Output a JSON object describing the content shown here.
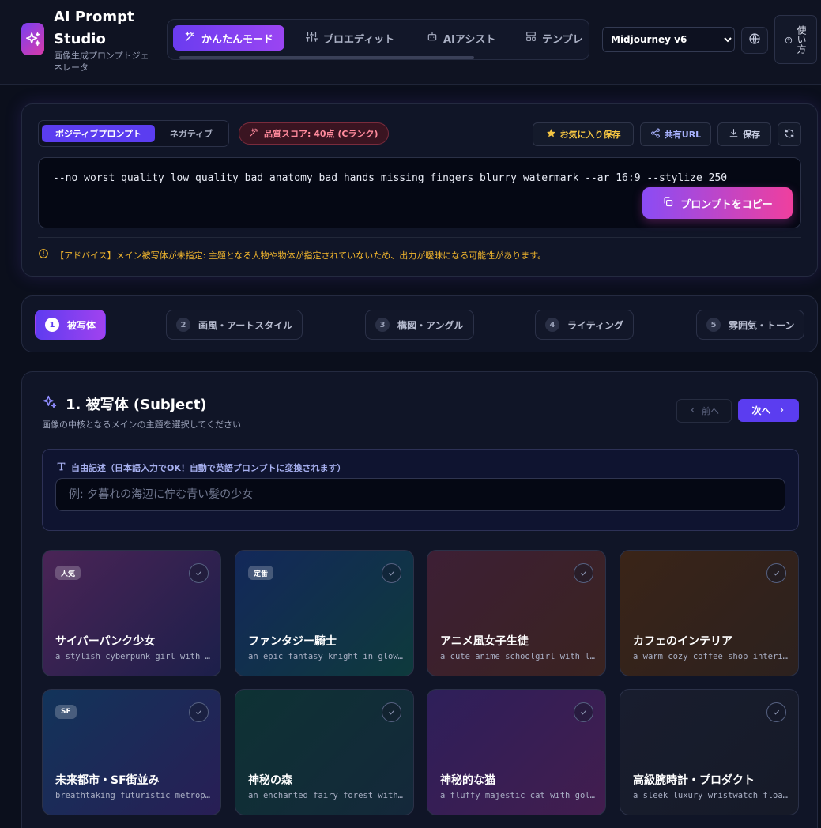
{
  "app": {
    "title": "AI Prompt Studio",
    "subtitle": "画像生成プロンプトジェネレータ"
  },
  "modes": [
    {
      "label": "かんたんモード",
      "icon": "magic-wand-icon",
      "active": true
    },
    {
      "label": "プロエディット",
      "icon": "sliders-icon",
      "active": false
    },
    {
      "label": "AIアシスト",
      "icon": "bot-icon",
      "active": false
    },
    {
      "label": "テンプレ",
      "icon": "layout-icon",
      "active": false
    }
  ],
  "model": {
    "selected": "Midjourney v6",
    "options": [
      "Midjourney v6"
    ]
  },
  "header_actions": {
    "language_icon": "globe-icon",
    "usage_label": "使い方"
  },
  "prompt": {
    "tabs": [
      {
        "label": "ポジティブプロンプト",
        "active": true
      },
      {
        "label": "ネガティブ",
        "active": false
      }
    ],
    "quality_score": "品質スコア: 40点 (Cランク)",
    "actions": {
      "favorite": "お気に入り保存",
      "share": "共有URL",
      "save": "保存"
    },
    "text": "--no worst quality low quality bad anatomy bad hands missing fingers blurry watermark --ar 16:9 --stylize 250",
    "copy_label": "プロンプトをコピー",
    "advice": "【アドバイス】メイン被写体が未指定: 主題となる人物や物体が指定されていないため、出力が曖昧になる可能性があります。"
  },
  "steps": [
    {
      "num": "1",
      "label": "被写体",
      "active": true
    },
    {
      "num": "2",
      "label": "画風・アートスタイル",
      "active": false
    },
    {
      "num": "3",
      "label": "構図・アングル",
      "active": false
    },
    {
      "num": "4",
      "label": "ライティング",
      "active": false
    },
    {
      "num": "5",
      "label": "雰囲気・トーン",
      "active": false
    }
  ],
  "section": {
    "title": "1. 被写体 (Subject)",
    "subtitle": "画像の中核となるメインの主題を選択してください",
    "prev_label": "前へ",
    "next_label": "次へ",
    "free_label": "自由記述（日本語入力でOK！自動で英語プロンプトに変換されます）",
    "free_placeholder": "例: 夕暮れの海辺に佇む青い髪の少女"
  },
  "cards": [
    {
      "badge": "人気",
      "title": "サイバーパンク少女",
      "desc": "a stylish cyberpunk girl with neon lights",
      "colors": [
        "#4a2456",
        "#1c1f4a"
      ]
    },
    {
      "badge": "定番",
      "title": "ファンタジー騎士",
      "desc": "an epic fantasy knight in glowing armor",
      "colors": [
        "#13285a",
        "#0e3a3c"
      ]
    },
    {
      "badge": "",
      "title": "アニメ風女子生徒",
      "desc": "a cute anime schoolgirl with long hair",
      "colors": [
        "#3d1f35",
        "#3a2320"
      ]
    },
    {
      "badge": "",
      "title": "カフェのインテリア",
      "desc": "a warm cozy coffee shop interior",
      "colors": [
        "#3a2418",
        "#2c211e"
      ]
    },
    {
      "badge": "SF",
      "title": "未来都市・SF街並み",
      "desc": "breathtaking futuristic metropolis",
      "colors": [
        "#12345a",
        "#281e55"
      ]
    },
    {
      "badge": "",
      "title": "神秘の森",
      "desc": "an enchanted fairy forest with glowing",
      "colors": [
        "#0e3234",
        "#14283a"
      ]
    },
    {
      "badge": "",
      "title": "神秘的な猫",
      "desc": "a fluffy majestic cat with golden eyes",
      "colors": [
        "#2e1f5a",
        "#421d4e"
      ]
    },
    {
      "badge": "",
      "title": "高級腕時計・プロダクト",
      "desc": "a sleek luxury wristwatch floating",
      "colors": [
        "#181d2e",
        "#161a28"
      ]
    }
  ]
}
